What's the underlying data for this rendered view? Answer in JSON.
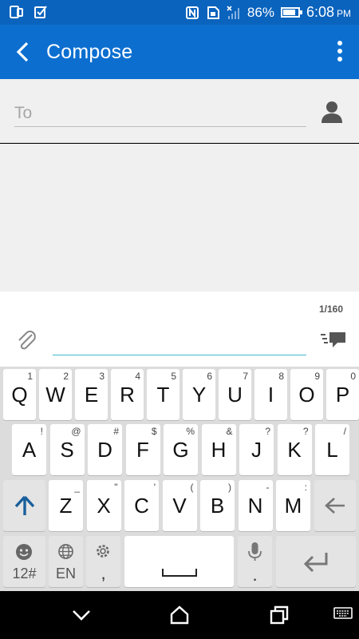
{
  "status_bar": {
    "battery_percent_label": "86%",
    "battery_level": 0.86,
    "time": "6:08",
    "ampm": "PM",
    "icons": [
      "phone-screen-icon",
      "checkbox-icon",
      "nfc-icon",
      "sim-icon",
      "signal-icon",
      "battery-icon"
    ]
  },
  "app_bar": {
    "title": "Compose"
  },
  "recipient": {
    "placeholder": "To"
  },
  "compose": {
    "char_count": "1/160",
    "message_value": ""
  },
  "keyboard": {
    "row1": [
      {
        "main": "Q",
        "hint": "1"
      },
      {
        "main": "W",
        "hint": "2"
      },
      {
        "main": "E",
        "hint": "3"
      },
      {
        "main": "R",
        "hint": "4"
      },
      {
        "main": "T",
        "hint": "5"
      },
      {
        "main": "Y",
        "hint": "6"
      },
      {
        "main": "U",
        "hint": "7"
      },
      {
        "main": "I",
        "hint": "8"
      },
      {
        "main": "O",
        "hint": "9"
      },
      {
        "main": "P",
        "hint": "0"
      }
    ],
    "row2": [
      {
        "main": "A",
        "hint": "!"
      },
      {
        "main": "S",
        "hint": "@"
      },
      {
        "main": "D",
        "hint": "#"
      },
      {
        "main": "F",
        "hint": "$"
      },
      {
        "main": "G",
        "hint": "%"
      },
      {
        "main": "H",
        "hint": "&"
      },
      {
        "main": "J",
        "hint": "?"
      },
      {
        "main": "K",
        "hint": "?"
      },
      {
        "main": "L",
        "hint": "/"
      }
    ],
    "row3": [
      {
        "main": "Z",
        "hint": "_"
      },
      {
        "main": "X",
        "hint": "\""
      },
      {
        "main": "C",
        "hint": "'"
      },
      {
        "main": "V",
        "hint": "("
      },
      {
        "main": "B",
        "hint": ")"
      },
      {
        "main": "N",
        "hint": "-"
      },
      {
        "main": "M",
        "hint": ":"
      }
    ],
    "symbols_label": "12#",
    "language_label": "EN",
    "comma_label": ",",
    "period_label": "."
  },
  "colors": {
    "status_bar": "#0a63bd",
    "app_bar": "#0c6fd0",
    "accent": "#43b7cc",
    "shift_arrow": "#1a5f9c"
  }
}
